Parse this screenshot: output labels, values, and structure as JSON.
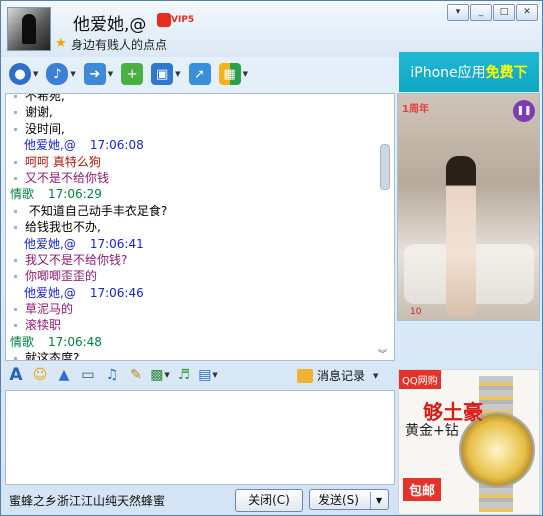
{
  "header": {
    "nickname": "他爱她,@",
    "vip_label": "VIP5",
    "signature": "身边有贱人的点点"
  },
  "window_buttons": [
    {
      "name": "skin",
      "glyph": "▾"
    },
    {
      "name": "minimize",
      "glyph": "_"
    },
    {
      "name": "maximize",
      "glyph": "□"
    },
    {
      "name": "close",
      "glyph": "✕"
    }
  ],
  "banner": {
    "text_white": "iPhone应用",
    "text_yellow": "免费下"
  },
  "toolbar": {
    "icons": [
      "video-call-icon",
      "voice-call-icon",
      "send-file-icon",
      "group-chat-icon",
      "remote-assist-icon",
      "screen-share-icon",
      "apps-icon"
    ]
  },
  "chat": {
    "messages": [
      {
        "kind": "body",
        "text": "不希宛,"
      },
      {
        "kind": "body",
        "text": "谢谢,"
      },
      {
        "kind": "body",
        "text": "没时间,"
      },
      {
        "kind": "me",
        "name": "他爱她,@",
        "time": "17:06:08"
      },
      {
        "kind": "body",
        "text": "呵呵 真特么狗",
        "color": "#b01414"
      },
      {
        "kind": "body",
        "text": "又不是不给你钱",
        "color": "#8c1a70"
      },
      {
        "kind": "other",
        "name": "情歌",
        "time": "17:06:29"
      },
      {
        "kind": "body",
        "text": "        不知道自己动手丰衣足食?"
      },
      {
        "kind": "body",
        "text": "给钱我也不办,"
      },
      {
        "kind": "me",
        "name": "他爱她,@",
        "time": "17:06:41"
      },
      {
        "kind": "body",
        "text": "我又不是不给你钱?",
        "color": "#8c1a70"
      },
      {
        "kind": "body",
        "text": "你唧唧歪歪的",
        "color": "#8c1a70"
      },
      {
        "kind": "me",
        "name": "他爱她,@",
        "time": "17:06:46"
      },
      {
        "kind": "body",
        "text": "草泥马的",
        "color": "#8c1a70"
      },
      {
        "kind": "body",
        "text": "滚犊职",
        "color": "#8c1a70"
      },
      {
        "kind": "other",
        "name": "情歌",
        "time": "17:06:48"
      },
      {
        "kind": "body",
        "text": "就这态度?"
      }
    ]
  },
  "video": {
    "tag": "1周年",
    "viewers": "10"
  },
  "input_toolbar": {
    "icons": [
      "font-icon",
      "emoji-icon",
      "bell-icon",
      "capture-icon",
      "voice-msg-icon",
      "scribble-icon",
      "image-icon",
      "music-icon",
      "screenshot-icon"
    ],
    "history_label": "消息记录"
  },
  "footer": {
    "ad_text": "蜜蜂之乡浙江江山纯天然蜂蜜",
    "close_label": "关闭(C)",
    "send_label": "发送(S)"
  },
  "side_ad": {
    "badge": "QQ网购",
    "headline": "够土豪",
    "line1": "黄金+钻",
    "cta": "包邮"
  }
}
